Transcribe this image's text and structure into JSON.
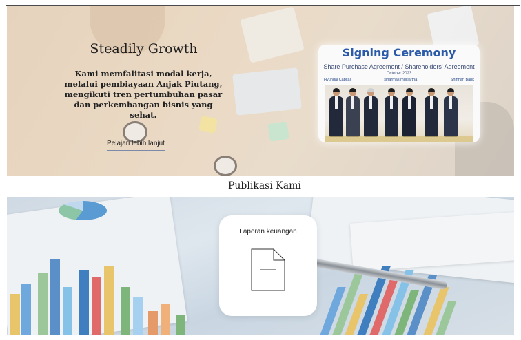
{
  "hero": {
    "title": "Steadily Growth",
    "description": "Kami memfalitasi modal kerja, melalui pembiayaan Anjak Piutang, mengikuti tren pertumbuhan pasar dan perkembangan bisnis yang sehat.",
    "link_label": "Pelajari lebih lanjut",
    "signing_card": {
      "title": "Signing Ceremony",
      "subtitle": "Share Purchase Agreement / Shareholders' Agreement",
      "date": "October 2023",
      "logos": [
        "Hyundai Capital",
        "sinarmas multiartha",
        "Shinhan Bank"
      ]
    }
  },
  "publications": {
    "heading": "Publikasi Kami",
    "cards": [
      {
        "label": "Laporan keuangan",
        "icon": "document-icon"
      }
    ]
  },
  "colors": {
    "accent_link": "#7a8aa8",
    "signing_title": "#2a5aa8"
  }
}
